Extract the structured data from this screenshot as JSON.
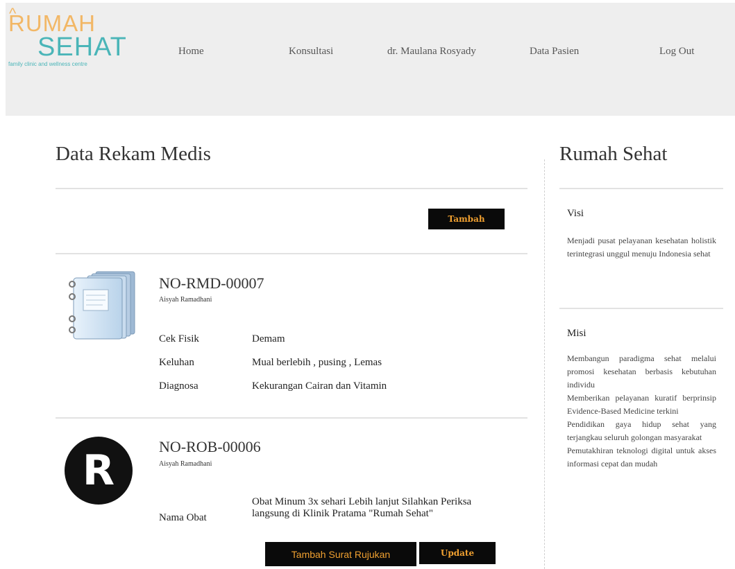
{
  "logo": {
    "line1": "RUMAH",
    "line2": "SEHAT",
    "tagline": "family clinic and wellness centre"
  },
  "nav": [
    {
      "label": "Home"
    },
    {
      "label": "Konsultasi"
    },
    {
      "label": "dr. Maulana Rosyady"
    },
    {
      "label": "Data Pasien"
    },
    {
      "label": "Log Out"
    }
  ],
  "main": {
    "title": "Data Rekam Medis",
    "add_button": "Tambah",
    "records": [
      {
        "icon": "notebook-icon",
        "code": "NO-RMD-00007",
        "patient": "Aisyah Ramadhani",
        "fields": [
          {
            "label": "Cek Fisik",
            "value": "Demam"
          },
          {
            "label": "Keluhan",
            "value": "Mual berlebih , pusing , Lemas"
          },
          {
            "label": "Diagnosa",
            "value": "Kekurangan Cairan dan Vitamin"
          }
        ]
      },
      {
        "icon": "letter-r-icon",
        "code": "NO-ROB-00006",
        "patient": "Aisyah Ramadhani",
        "fields": [
          {
            "label": "Nama Obat",
            "value": "Obat Minum 3x sehari Lebih lanjut Silahkan Periksa langsung di Klinik Pratama \"Rumah Sehat\""
          }
        ],
        "referral_button": "Tambah Surat Rujukan",
        "update_button": "Update"
      }
    ]
  },
  "sidebar": {
    "title": "Rumah Sehat",
    "visi_heading": "Visi",
    "visi_text": "Menjadi pusat pelayanan kesehatan holistik terintegrasi unggul menuju Indonesia sehat",
    "misi_heading": "Misi",
    "misi_items": [
      "Membangun paradigma sehat melalui promosi kesehatan berbasis kebutuhan individu",
      "Memberikan pelayanan kuratif berprinsip Evidence-Based Medicine terkini",
      "Pendidikan gaya hidup sehat yang terjangkau seluruh golongan masyarakat",
      "Pemutakhiran teknologi digital untuk akses informasi cepat dan mudah"
    ]
  },
  "colors": {
    "header_bg": "#eeeeee",
    "button_bg": "#0a0a0a",
    "button_text": "#f0a030",
    "logo_orange": "#f2b766",
    "logo_teal": "#4ab5b8"
  }
}
